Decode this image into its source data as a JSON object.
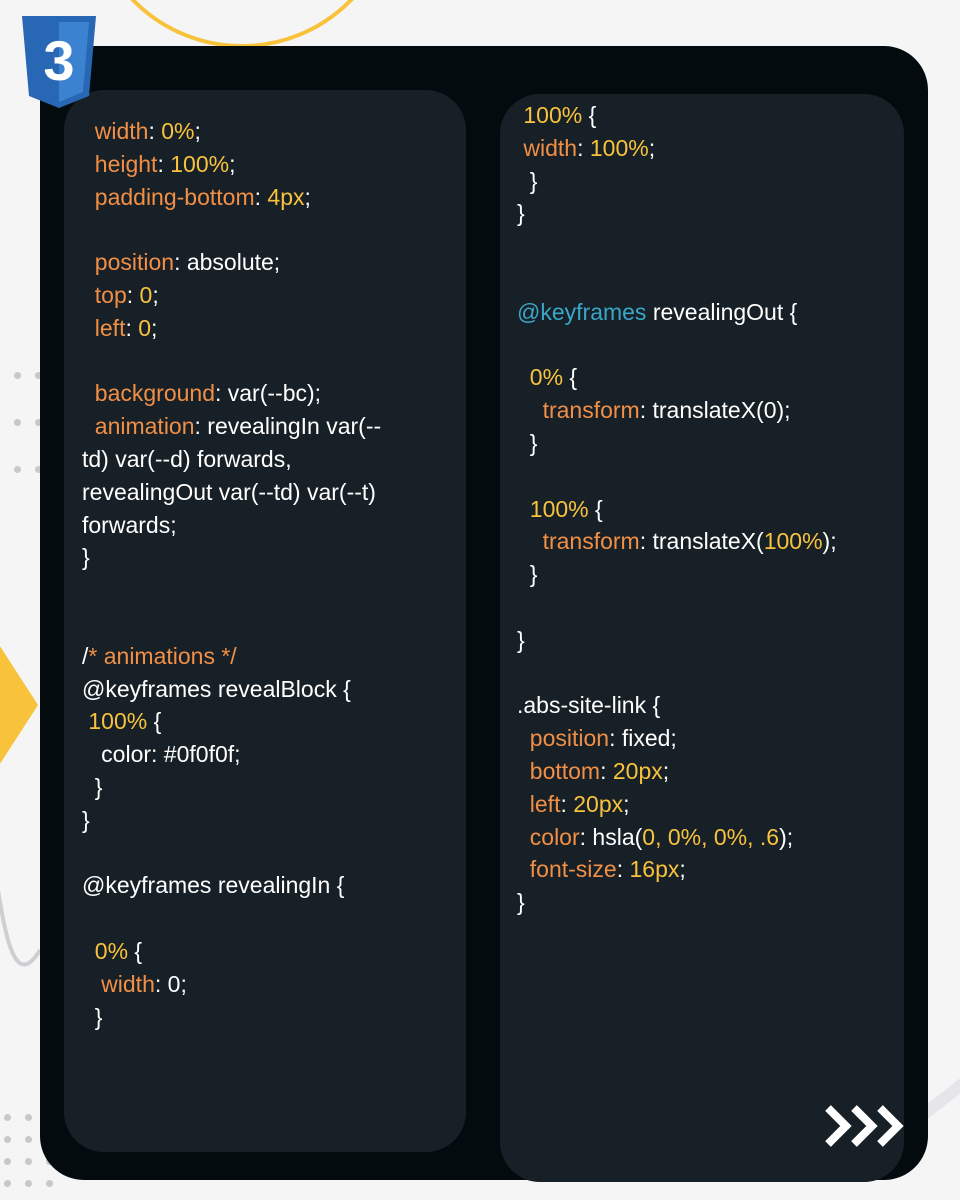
{
  "brand": {
    "icon": "css3-shield-icon",
    "label": "3"
  },
  "colors": {
    "card_bg": "#030b0e",
    "panel_bg": "#172026",
    "property": "#f28f45",
    "value": "#f9c23c",
    "keyword": "#3aa6c9",
    "text": "#ffffff",
    "accent_yellow": "#f8c23a",
    "css_blue": "#2867b3"
  },
  "navigation": {
    "next_icon": "triple-chevron-right-icon"
  },
  "left_panel": {
    "lines": [
      [
        {
          "t": "  ",
          "c": "t"
        },
        {
          "t": "width",
          "c": "p"
        },
        {
          "t": ": ",
          "c": "t"
        },
        {
          "t": "0%",
          "c": "v"
        },
        {
          "t": ";",
          "c": "t"
        }
      ],
      [
        {
          "t": "  ",
          "c": "t"
        },
        {
          "t": "height",
          "c": "p"
        },
        {
          "t": ": ",
          "c": "t"
        },
        {
          "t": "100%",
          "c": "v"
        },
        {
          "t": ";",
          "c": "t"
        }
      ],
      [
        {
          "t": "  ",
          "c": "t"
        },
        {
          "t": "padding-bottom",
          "c": "p"
        },
        {
          "t": ": ",
          "c": "t"
        },
        {
          "t": "4px",
          "c": "v"
        },
        {
          "t": ";",
          "c": "t"
        }
      ],
      [],
      [
        {
          "t": "  ",
          "c": "t"
        },
        {
          "t": "position",
          "c": "p"
        },
        {
          "t": ": absolute;",
          "c": "t"
        }
      ],
      [
        {
          "t": "  ",
          "c": "t"
        },
        {
          "t": "top",
          "c": "p"
        },
        {
          "t": ": ",
          "c": "t"
        },
        {
          "t": "0",
          "c": "v"
        },
        {
          "t": ";",
          "c": "t"
        }
      ],
      [
        {
          "t": "  ",
          "c": "t"
        },
        {
          "t": "left",
          "c": "p"
        },
        {
          "t": ": ",
          "c": "t"
        },
        {
          "t": "0",
          "c": "v"
        },
        {
          "t": ";",
          "c": "t"
        }
      ],
      [],
      [
        {
          "t": "  ",
          "c": "t"
        },
        {
          "t": "background",
          "c": "p"
        },
        {
          "t": ": var(--bc);",
          "c": "t"
        }
      ],
      [
        {
          "t": "  ",
          "c": "t"
        },
        {
          "t": "animation",
          "c": "p"
        },
        {
          "t": ": revealingIn var(--",
          "c": "t"
        }
      ],
      [
        {
          "t": "td) var(--d) forwards,",
          "c": "t"
        }
      ],
      [
        {
          "t": "revealingOut var(--td) var(--t)",
          "c": "t"
        }
      ],
      [
        {
          "t": "forwards;",
          "c": "t"
        }
      ],
      [
        {
          "t": "}",
          "c": "t"
        }
      ],
      [],
      [],
      [
        {
          "t": "/",
          "c": "t"
        },
        {
          "t": "* animations */",
          "c": "p"
        }
      ],
      [
        {
          "t": "@keyframes revealBlock {",
          "c": "t"
        }
      ],
      [
        {
          "t": " ",
          "c": "t"
        },
        {
          "t": "100%",
          "c": "v"
        },
        {
          "t": " {",
          "c": "t"
        }
      ],
      [
        {
          "t": "   color: #0f0f0f;",
          "c": "t"
        }
      ],
      [
        {
          "t": "  }",
          "c": "t"
        }
      ],
      [
        {
          "t": "}",
          "c": "t"
        }
      ],
      [],
      [
        {
          "t": "@keyframes revealingIn {",
          "c": "t"
        }
      ],
      [],
      [
        {
          "t": "  ",
          "c": "t"
        },
        {
          "t": "0%",
          "c": "v"
        },
        {
          "t": " {",
          "c": "t"
        }
      ],
      [
        {
          "t": "   ",
          "c": "t"
        },
        {
          "t": "width",
          "c": "p"
        },
        {
          "t": ": 0;",
          "c": "t"
        }
      ],
      [
        {
          "t": "  }",
          "c": "t"
        }
      ]
    ]
  },
  "right_panel": {
    "lines": [
      [
        {
          "t": " ",
          "c": "t"
        },
        {
          "t": "100%",
          "c": "v"
        },
        {
          "t": " {",
          "c": "t"
        }
      ],
      [
        {
          "t": " ",
          "c": "t"
        },
        {
          "t": "width",
          "c": "p"
        },
        {
          "t": ": ",
          "c": "t"
        },
        {
          "t": "100%",
          "c": "v"
        },
        {
          "t": ";",
          "c": "t"
        }
      ],
      [
        {
          "t": "  }",
          "c": "t"
        }
      ],
      [
        {
          "t": "}",
          "c": "t"
        }
      ],
      [],
      [],
      [
        {
          "t": "@keyframes",
          "c": "k"
        },
        {
          "t": " revealingOut {",
          "c": "t"
        }
      ],
      [],
      [
        {
          "t": "  ",
          "c": "t"
        },
        {
          "t": "0%",
          "c": "v"
        },
        {
          "t": " {",
          "c": "t"
        }
      ],
      [
        {
          "t": "    ",
          "c": "t"
        },
        {
          "t": "transform",
          "c": "p"
        },
        {
          "t": ": translateX(0);",
          "c": "t"
        }
      ],
      [
        {
          "t": "  }",
          "c": "t"
        }
      ],
      [],
      [
        {
          "t": "  ",
          "c": "t"
        },
        {
          "t": "100%",
          "c": "v"
        },
        {
          "t": " {",
          "c": "t"
        }
      ],
      [
        {
          "t": "    ",
          "c": "t"
        },
        {
          "t": "transform",
          "c": "p"
        },
        {
          "t": ": translateX(",
          "c": "t"
        },
        {
          "t": "100%",
          "c": "v"
        },
        {
          "t": ");",
          "c": "t"
        }
      ],
      [
        {
          "t": "  }",
          "c": "t"
        }
      ],
      [],
      [
        {
          "t": "}",
          "c": "t"
        }
      ],
      [],
      [
        {
          "t": ".abs-site-link {",
          "c": "t"
        }
      ],
      [
        {
          "t": "  ",
          "c": "t"
        },
        {
          "t": "position",
          "c": "p"
        },
        {
          "t": ": fixed;",
          "c": "t"
        }
      ],
      [
        {
          "t": "  ",
          "c": "t"
        },
        {
          "t": "bottom",
          "c": "p"
        },
        {
          "t": ": ",
          "c": "t"
        },
        {
          "t": "20px",
          "c": "v"
        },
        {
          "t": ";",
          "c": "t"
        }
      ],
      [
        {
          "t": "  ",
          "c": "t"
        },
        {
          "t": "left",
          "c": "p"
        },
        {
          "t": ": ",
          "c": "t"
        },
        {
          "t": "20px",
          "c": "v"
        },
        {
          "t": ";",
          "c": "t"
        }
      ],
      [
        {
          "t": "  ",
          "c": "t"
        },
        {
          "t": "color",
          "c": "p"
        },
        {
          "t": ": hsla(",
          "c": "t"
        },
        {
          "t": "0, 0%, 0%, .6",
          "c": "v"
        },
        {
          "t": ");",
          "c": "t"
        }
      ],
      [
        {
          "t": "  ",
          "c": "t"
        },
        {
          "t": "font-size",
          "c": "p"
        },
        {
          "t": ": ",
          "c": "t"
        },
        {
          "t": "16px",
          "c": "v"
        },
        {
          "t": ";",
          "c": "t"
        }
      ],
      [
        {
          "t": "}",
          "c": "t"
        }
      ]
    ]
  }
}
